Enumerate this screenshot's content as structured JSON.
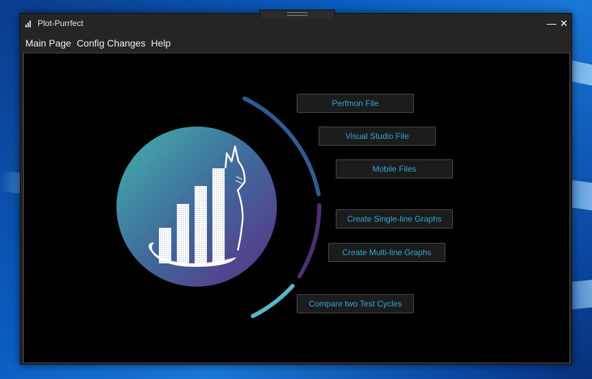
{
  "window": {
    "title": "Plot-Purrfect",
    "minimize_label": "—",
    "close_label": "✕"
  },
  "menu": {
    "items": [
      "Main Page",
      "Config Changes",
      "Help"
    ]
  },
  "buttons": {
    "perfmon": "Perfmon File",
    "visual_studio": "Visual Studio File",
    "mobile": "Mobile Files",
    "single_line": "Create Single-line Graphs",
    "multi_line": "Create Multi-line Graphs",
    "compare": "Compare two Test Cycles"
  },
  "colors": {
    "button_text": "#2fa8d8",
    "arc_blue": "#2e5c8f",
    "arc_purple": "#4e2f6e",
    "arc_teal": "#5bb5c8",
    "logo_teal": "#3fa7a8",
    "logo_purple": "#5a3a8a"
  },
  "icons": {
    "app": "bar-chart-icon",
    "logo": "cat-bar-chart-logo"
  }
}
